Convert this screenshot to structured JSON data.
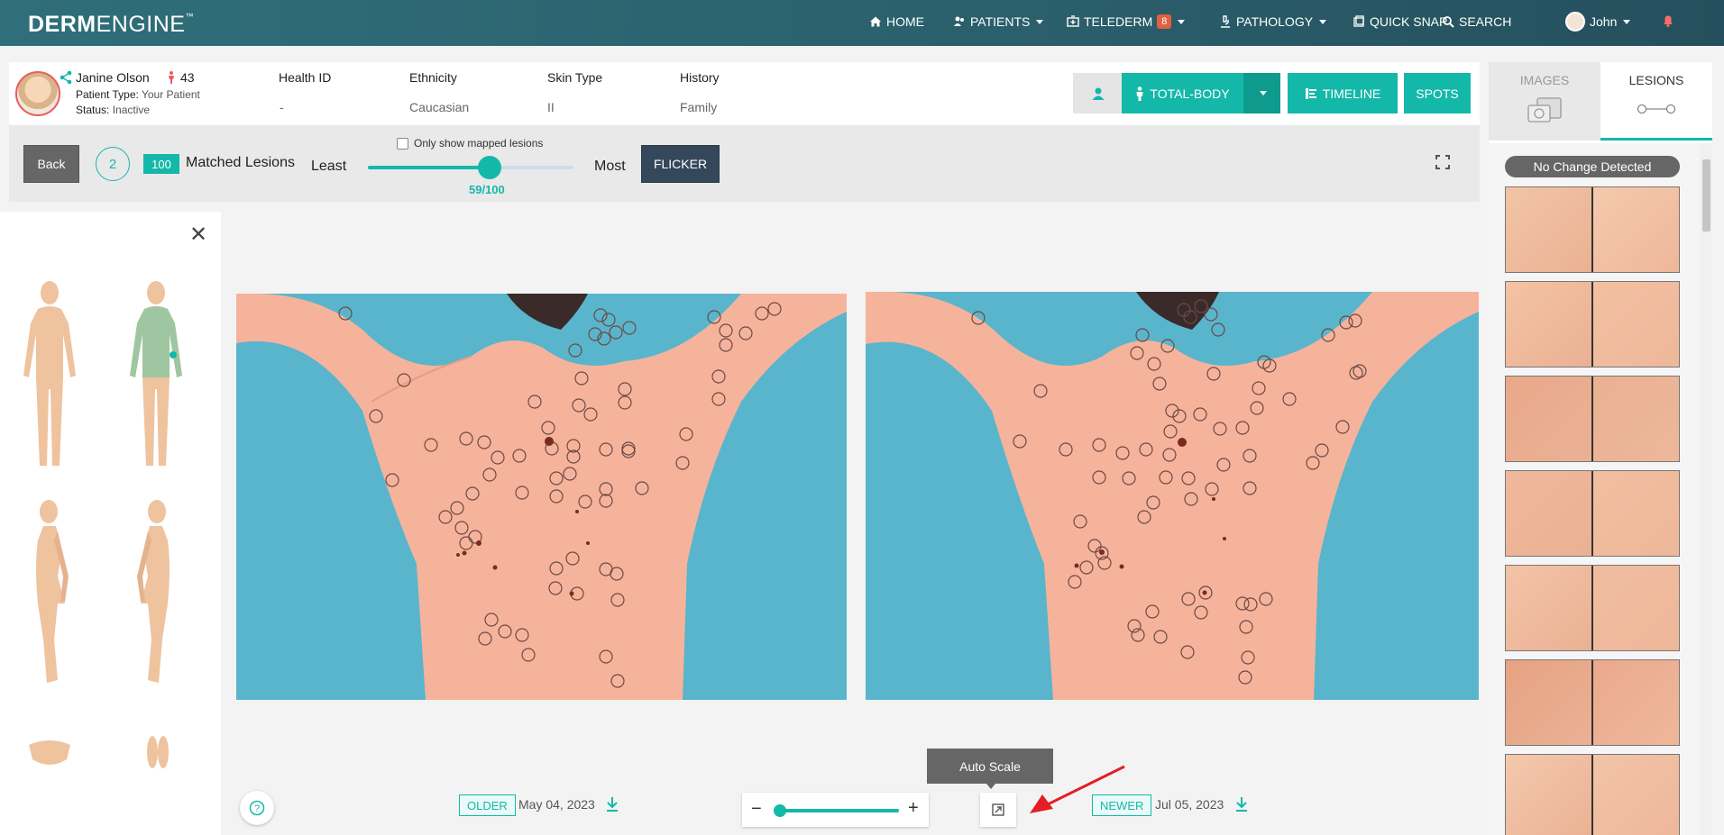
{
  "nav": {
    "logo_bold": "DERM",
    "logo_light": "ENGINE",
    "logo_tm": "™",
    "home": "HOME",
    "patients": "PATIENTS",
    "telederm": "TELEDERM",
    "telederm_badge": "8",
    "pathology": "PATHOLOGY",
    "quick_snap": "QUICK SNAP",
    "search": "SEARCH",
    "user": "John"
  },
  "patient": {
    "name": "Janine Olson",
    "age": "43",
    "type_label": "Patient Type:",
    "type_value": "Your Patient",
    "status_label": "Status:",
    "status_value": "Inactive",
    "columns": [
      {
        "header": "Health ID",
        "value": "-"
      },
      {
        "header": "Ethnicity",
        "value": "Caucasian"
      },
      {
        "header": "Skin Type",
        "value": "II"
      },
      {
        "header": "History",
        "value": "Family"
      }
    ],
    "btn_total_body": "TOTAL-BODY",
    "btn_timeline": "TIMELINE",
    "btn_spots": "SPOTS"
  },
  "toolbar": {
    "back": "Back",
    "step": "2",
    "matched_count": "100",
    "matched_label": "Matched Lesions",
    "least": "Least",
    "most": "Most",
    "mapped_only": "Only show mapped lesions",
    "slider_value": 59,
    "slider_max": 100,
    "slider_text": "59/100",
    "flicker": "FLICKER"
  },
  "comparison": {
    "older_tag": "OLDER",
    "older_date": "May 04, 2023",
    "newer_tag": "NEWER",
    "newer_date": "Jul 05, 2023",
    "tooltip": "Auto Scale",
    "zoom_level": 0
  },
  "right_panel": {
    "tab_images": "IMAGES",
    "tab_lesions": "LESIONS",
    "status": "No Change Detected",
    "pair_count": 7
  },
  "colors": {
    "accent": "#14b8a9",
    "nav_bg": "#2a5f6b",
    "dark_button": "#35475a",
    "skin": "#f2b79a",
    "photo_bg": "#59b5cc"
  }
}
